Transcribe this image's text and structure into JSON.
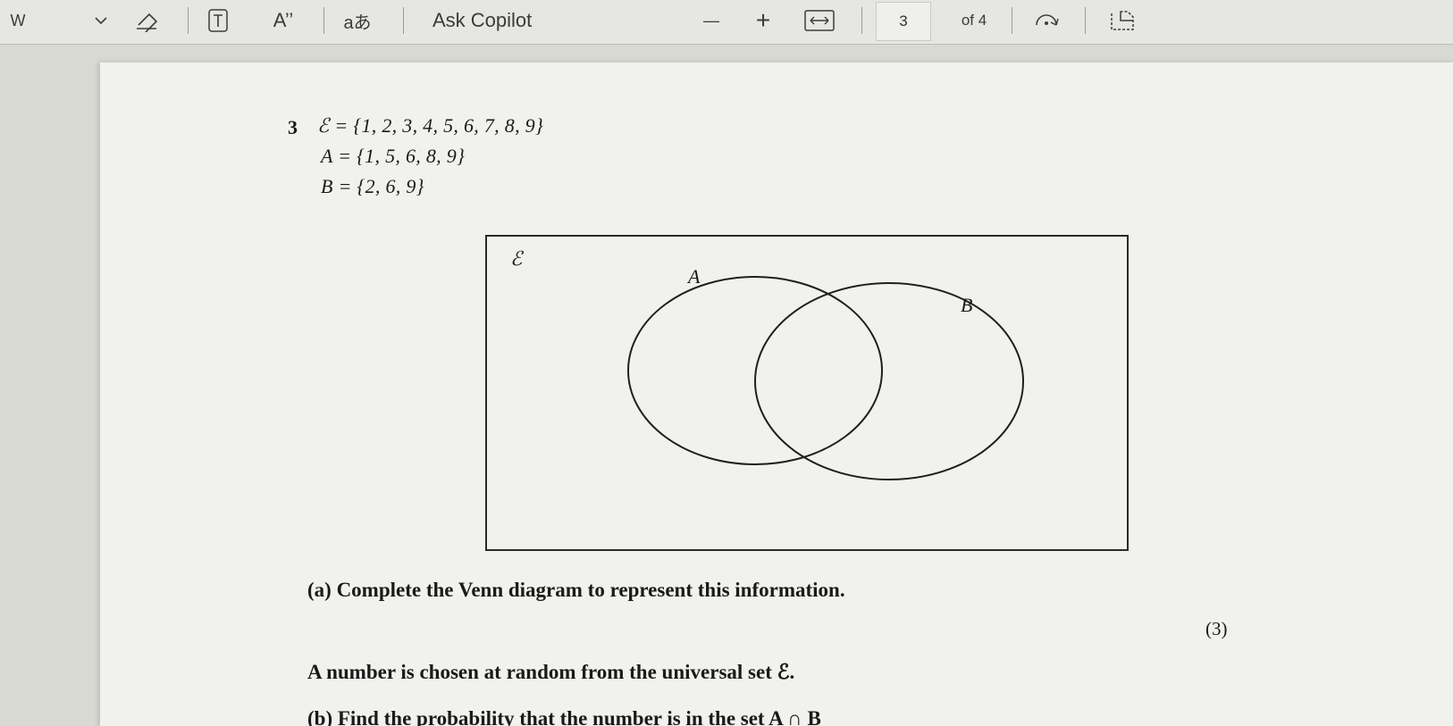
{
  "toolbar": {
    "lang_label": "W",
    "immersive_label": "A’’",
    "translate_label": "aあ",
    "copilot_label": "Ask Copilot",
    "zoom_out_label": "—",
    "zoom_in_label": "+",
    "current_page": "3",
    "page_total": "of 4"
  },
  "document": {
    "question_number": "3",
    "universal_set": "ℰ = {1, 2, 3, 4, 5, 6, 7, 8, 9}",
    "set_a": "A = {1, 5, 6, 8, 9}",
    "set_b": "B = {2, 6, 9}",
    "venn": {
      "universal_label": "ℰ",
      "label_a": "A",
      "label_b": "B"
    },
    "part_a": "(a)  Complete the Venn diagram to represent this information.",
    "part_a_marks": "(3)",
    "random_text": "A number is chosen at random from the universal set ℰ.",
    "part_b": "(b)  Find the probability that the number is in the set A ∩ B"
  },
  "colors": {
    "toolbar_bg": "#e6e6e2",
    "page_bg": "#f1f1ee",
    "ink": "#1a1a1a"
  }
}
